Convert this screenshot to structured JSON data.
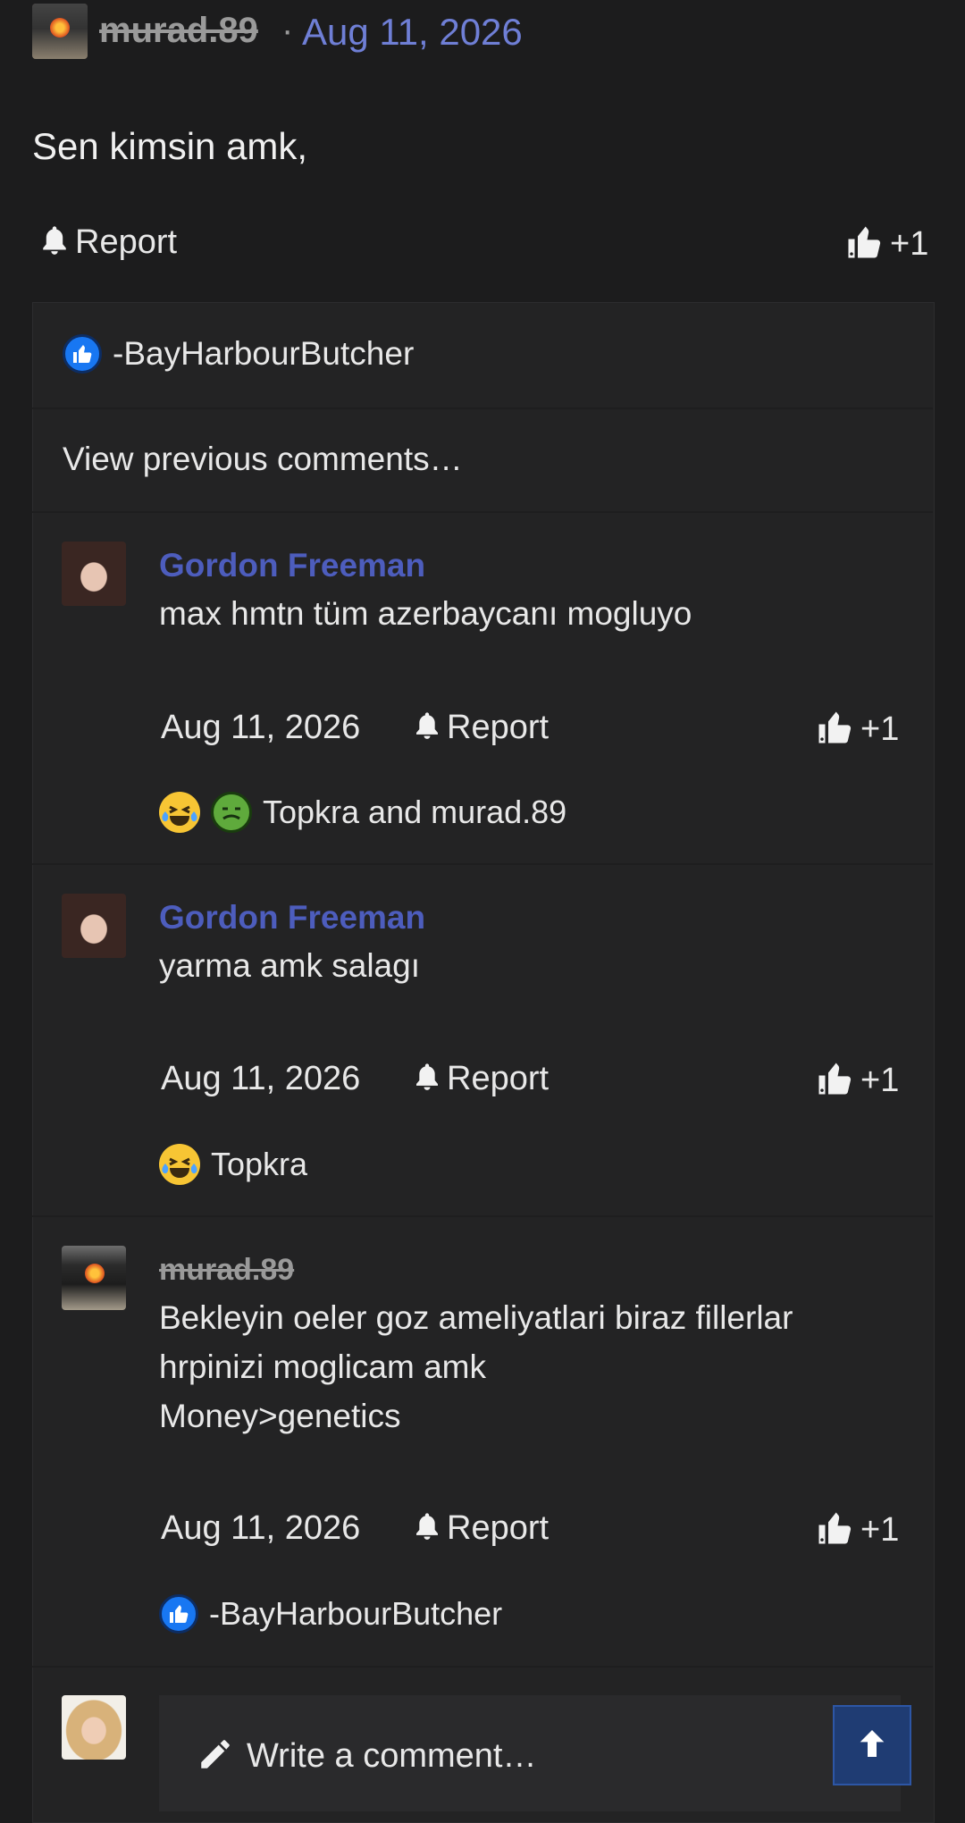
{
  "post": {
    "author": "murad.89",
    "separator": "·",
    "date": "Aug 11, 2026",
    "body": "Sen kimsin amk,",
    "report_label": "Report",
    "like_label": "+1"
  },
  "reactions_bar": {
    "users": "-BayHarbourButcher"
  },
  "view_previous": "View previous comments…",
  "comments": [
    {
      "author": "Gordon Freeman",
      "body": [
        "max hmtn tüm azerbaycanı mogluyo"
      ],
      "date": "Aug 11, 2026",
      "report_label": "Report",
      "like_label": "+1",
      "reactions": [
        "laugh-cry",
        "nauseated"
      ],
      "reaction_users": "Topkra and murad.89"
    },
    {
      "author": "Gordon Freeman",
      "body": [
        "yarma amk salagı"
      ],
      "date": "Aug 11, 2026",
      "report_label": "Report",
      "like_label": "+1",
      "reactions": [
        "laugh-cry"
      ],
      "reaction_users": "Topkra"
    },
    {
      "author": "murad.89",
      "body": [
        "Bekleyin oeler goz ameliyatlari biraz fillerlar",
        "hrpinizi moglicam amk",
        "Money>genetics"
      ],
      "date": "Aug 11, 2026",
      "report_label": "Report",
      "like_label": "+1",
      "reactions": [
        "like"
      ],
      "reaction_users": "-BayHarbourButcher"
    }
  ],
  "composer": {
    "placeholder": "Write a comment…"
  },
  "icons": {
    "report": "bell-icon",
    "like": "thumbs-up-icon",
    "compose": "pencil-icon",
    "scroll": "arrow-up-icon"
  },
  "colors": {
    "background": "#1c1c1d",
    "panel": "#232324",
    "link": "#6f7fd6",
    "username": "#4d5dbd",
    "like_reaction": "#1877f2",
    "scroll_button": "#1f3c73"
  }
}
